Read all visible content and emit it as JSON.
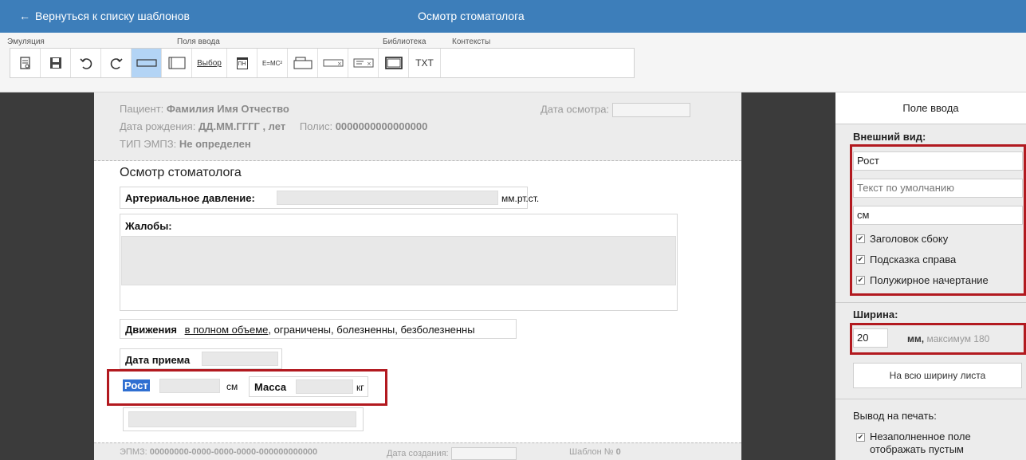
{
  "topbar": {
    "back_label": "Вернуться к списку шаблонов",
    "title": "Осмотр стоматолога"
  },
  "toolbar": {
    "groups": {
      "emulation": "Эмуляция",
      "fields": "Поля ввода",
      "library": "Библиотека",
      "contexts": "Контексты"
    },
    "select_label": "Выбор",
    "date_label": "ПН",
    "formula_label": "E=MC²",
    "txt_label": "TXT"
  },
  "document": {
    "patient_label": "Пациент:",
    "patient_value": "Фамилия Имя Отчество",
    "birth_label": "Дата рождения:",
    "birth_value": "ДД.ММ.ГГГГ , лет",
    "policy_label": "Полис:",
    "policy_value": "0000000000000000",
    "type_label": "ТИП ЭМПЗ:",
    "type_value": "Не определен",
    "exam_date_label": "Дата осмотра:",
    "title": "Осмотр стоматолога",
    "pressure_label": "Артериальное давление:",
    "pressure_unit": "мм.рт.ст.",
    "complaints_label": "Жалобы:",
    "movements_label": "Движения",
    "movements_options": [
      "в полном объеме",
      "ограничены",
      "болезненны",
      "безболезненны"
    ],
    "reception_label": "Дата приема",
    "height_label": "Рост",
    "height_unit": "см",
    "weight_label": "Масса",
    "weight_unit": "кг",
    "footer_emz_label": "ЭПМЗ:",
    "footer_emz_value": "00000000-0000-0000-0000-000000000000",
    "footer_created_label": "Дата создания:",
    "footer_template_label": "Шаблон №",
    "footer_template_value": "0"
  },
  "panel": {
    "title": "Поле ввода",
    "appearance_title": "Внешний вид:",
    "name_value": "Рост",
    "default_text_placeholder": "Текст по умолчанию",
    "unit_value": "см",
    "checkboxes": [
      "Заголовок сбоку",
      "Подсказка справа",
      "Полужирное начертание"
    ],
    "width_title": "Ширина:",
    "width_value": "20",
    "width_unit": "мм,",
    "width_max": "максимум 180",
    "full_width_button": "На всю ширину листа",
    "print_title": "Вывод на печать:",
    "print_checkbox": "Незаполненное поле отображать пустым"
  },
  "colors": {
    "topbar": "#3d7eba",
    "highlight": "#b2191f",
    "active_tool": "#b3d4f5"
  }
}
